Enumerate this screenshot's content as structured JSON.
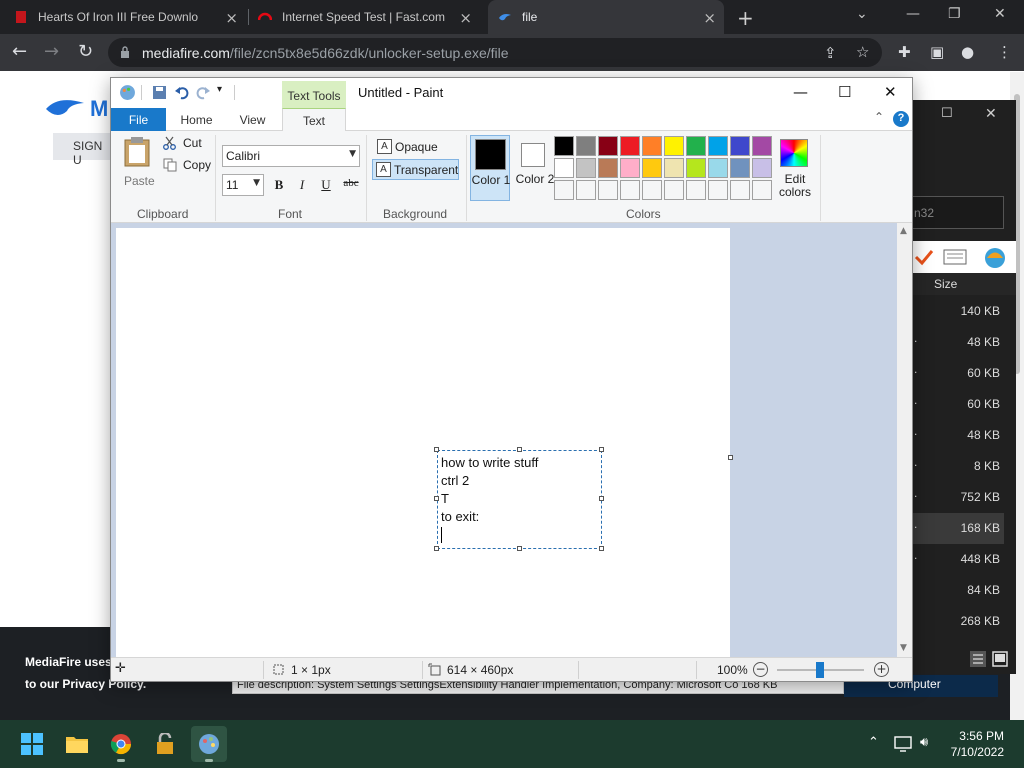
{
  "browser": {
    "tabs": [
      {
        "title": "Hearts Of Iron III Free Download"
      },
      {
        "title": "Internet Speed Test | Fast.com"
      },
      {
        "title": "file"
      }
    ],
    "url_host": "mediafire.com",
    "url_path": "/file/zcn5tx8e5d66zdk/unlocker-setup.exe/file"
  },
  "webpage": {
    "signup_label": "SIGN U",
    "notice_line1": "MediaFire uses",
    "notice_line2": "to our Privacy Policy.",
    "file_description": "File description: System Settings SettingsExtensibility Handler Implementation, Company: Microsoft Co 168 KB",
    "computer_label": "Computer"
  },
  "side_window": {
    "search_text": "n32",
    "size_header": "Size",
    "sizes": [
      "140 KB",
      "48 KB",
      "60 KB",
      "60 KB",
      "48 KB",
      "8 KB",
      "752 KB",
      "168 KB",
      "448 KB",
      "84 KB",
      "268 KB"
    ]
  },
  "paint": {
    "title": "Untitled - Paint",
    "context_tab": "Text Tools",
    "tabs": {
      "file": "File",
      "home": "Home",
      "view": "View",
      "text": "Text"
    },
    "help": "?",
    "clipboard": {
      "paste": "Paste",
      "cut": "Cut",
      "copy": "Copy",
      "label": "Clipboard"
    },
    "font": {
      "name": "Calibri",
      "size": "11",
      "bold": "B",
      "italic": "I",
      "underline": "U",
      "strike": "abc",
      "label": "Font"
    },
    "background": {
      "opaque": "Opaque",
      "transparent": "Transparent",
      "label": "Background"
    },
    "colors": {
      "color1": "Color 1",
      "color2": "Color 2",
      "edit": "Edit colors",
      "label": "Colors",
      "palette_row1": [
        "#000000",
        "#7f7f7f",
        "#880015",
        "#ed1c24",
        "#ff7f27",
        "#fff200",
        "#22b14c",
        "#00a2e8",
        "#3f48cc",
        "#a349a4"
      ],
      "palette_row2": [
        "#ffffff",
        "#c3c3c3",
        "#b97a57",
        "#ffaec9",
        "#ffc90e",
        "#efe4b0",
        "#b5e61d",
        "#99d9ea",
        "#7092be",
        "#c8bfe7"
      ]
    },
    "text_lines": [
      "how to write stuff",
      "ctrl 2",
      "T",
      "to exit:"
    ],
    "status": {
      "selection": "1 × 1px",
      "image_size": "614 × 460px",
      "zoom": "100%"
    }
  },
  "taskbar": {
    "time": "3:56 PM",
    "date": "7/10/2022"
  }
}
